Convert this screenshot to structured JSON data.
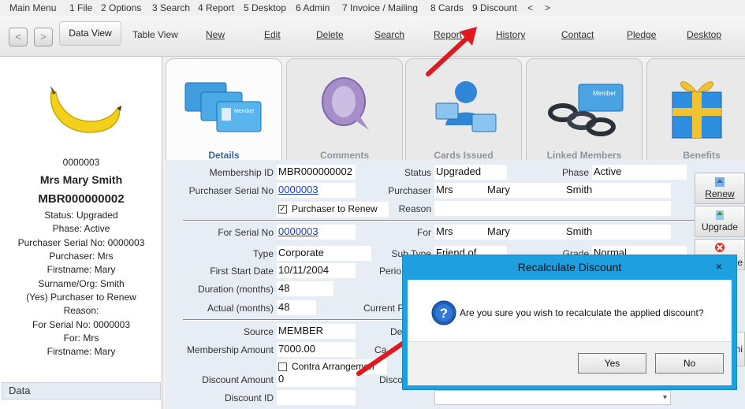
{
  "menu": {
    "items": [
      "Main Menu",
      "1 File",
      "2 Options",
      "3 Search",
      "4 Report",
      "5 Desktop",
      "6 Admin",
      "7 Invoice / Mailing",
      "8 Cards",
      "9 Discount",
      "<",
      ">"
    ]
  },
  "toolbar": {
    "data_view": "Data View",
    "table_view": "Table View",
    "new": "New",
    "edit": "Edit",
    "delete": "Delete",
    "search": "Search",
    "report": "Report",
    "history": "History",
    "contact": "Contact",
    "pledge": "Pledge",
    "desktop": "Desktop"
  },
  "sidebar": {
    "lines": [
      "0000003",
      "Mrs Mary Smith",
      "MBR000000002",
      "Status: Upgraded",
      "Phase: Active",
      "Purchaser Serial No: 0000003",
      "Purchaser: Mrs",
      "Firstname: Mary",
      "Surname/Org: Smith",
      "(Yes) Purchaser to Renew",
      "Reason:",
      "For Serial No: 0000003",
      "For: Mrs",
      "Firstname: Mary"
    ],
    "section_title": "Data"
  },
  "tabs": {
    "details": "Details",
    "comments": "Comments",
    "cards_issued": "Cards Issued",
    "linked_members": "Linked Members",
    "benefits": "Benefits",
    "member_card_text": "Member",
    "chain_text": "Member"
  },
  "form": {
    "membership_id_label": "Membership ID",
    "membership_id": "MBR000000002",
    "status_label": "Status",
    "status": "Upgraded",
    "phase_label": "Phase",
    "phase": "Active",
    "purchaser_serial_label": "Purchaser Serial No",
    "purchaser_serial": "0000003",
    "purchaser_label": "Purchaser",
    "purchaser_title": "Mrs",
    "purchaser_first": "Mary",
    "purchaser_last": "Smith",
    "purchaser_to_renew": "Purchaser to Renew",
    "reason_label": "Reason",
    "for_serial_label": "For Serial No",
    "for_serial": "0000003",
    "for_label": "For",
    "for_title": "Mrs",
    "for_first": "Mary",
    "for_last": "Smith",
    "type_label": "Type",
    "type": "Corporate",
    "subtype_label": "Sub Type",
    "subtype": "Friend of",
    "grade_label": "Grade",
    "grade": "Normal",
    "first_start_label": "First Start Date",
    "first_start": "10/11/2004",
    "period_label": "Perio",
    "duration_label": "Duration (months)",
    "duration": "48",
    "actual_label": "Actual (months)",
    "actual": "48",
    "current_label": "Current Per",
    "source_label": "Source",
    "source": "MEMBER",
    "de_label": "De",
    "membership_amount_label": "Membership Amount",
    "membership_amount": "7000.00",
    "ca_label": "Ca",
    "contra": "Contra Arrangemen",
    "discount_amount_label": "Discount Amount",
    "discount_amount": "0",
    "disc_label": "Discou",
    "discount_id_label": "Discount ID"
  },
  "right_buttons": {
    "renew": "Renew",
    "upgrade": "Upgrade",
    "partial_te": "te",
    "partial_hi": "hi"
  },
  "dialog": {
    "title": "Recalculate Discount",
    "close": "×",
    "message": "Are you sure you wish to recalculate the applied discount?",
    "yes": "Yes",
    "no": "No"
  }
}
